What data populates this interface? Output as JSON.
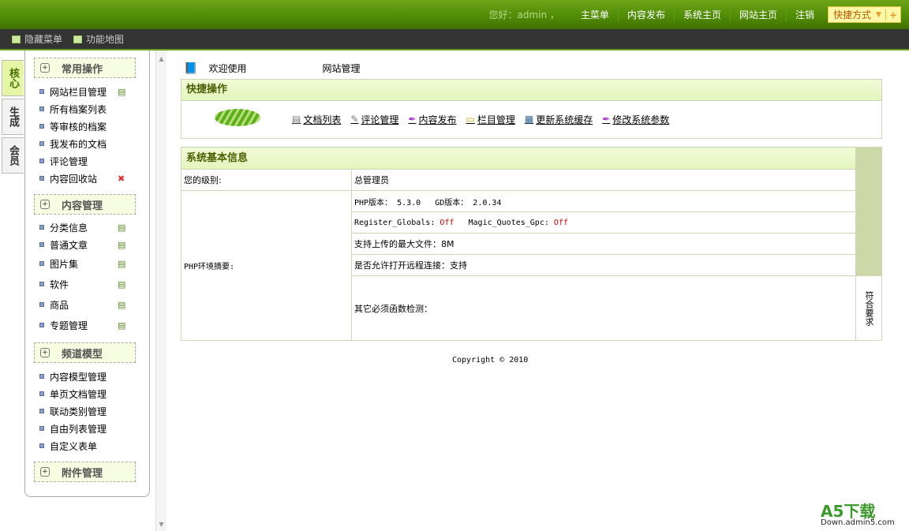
{
  "topnav": {
    "greeting": "您好：admin ，",
    "links": [
      "主菜单",
      "内容发布",
      "系统主页",
      "网站主页",
      "注销"
    ],
    "shortcut": "快捷方式"
  },
  "toolbar": {
    "hide_menu": "隐藏菜单",
    "sitemap": "功能地图"
  },
  "tabs": [
    "核心",
    "生成",
    "会员"
  ],
  "menu": [
    {
      "title": "常用操作",
      "items": [
        "网站栏目管理",
        "所有档案列表",
        "等审核的档案",
        "我发布的文档",
        "评论管理",
        "内容回收站"
      ]
    },
    {
      "title": "内容管理",
      "items": [
        "分类信息",
        "普通文章",
        "图片集",
        "软件",
        "商品",
        "专题管理"
      ]
    },
    {
      "title": "频道模型",
      "items": [
        "内容模型管理",
        "单页文档管理",
        "联动类别管理",
        "自由列表管理",
        "自定义表单"
      ]
    },
    {
      "title": "附件管理",
      "items": []
    }
  ],
  "welcome": {
    "text": "欢迎使用",
    "title": "网站管理"
  },
  "quick": {
    "title": "快捷操作",
    "links": [
      "文档列表",
      "评论管理",
      "内容发布",
      "栏目管理",
      "更新系统缓存",
      "修改系统参数"
    ]
  },
  "sysinfo": {
    "title": "系统基本信息",
    "level_label": "您的级别:",
    "level": "总管理员",
    "php_label": "PHP环境摘要:",
    "php_ver": "PHP版本： 5.3.0   GD版本： 2.0.34",
    "rg_label": "Register_Globals:",
    "rg": "Off",
    "mq_label": "Magic_Quotes_Gpc:",
    "mq": "Off",
    "upload": "支持上传的最大文件：8M",
    "remote": "是否允许打开远程连接：支持",
    "funcs": "其它必须函数检测：",
    "funcs_result": "符合要求"
  },
  "copyright": "Copyright © 2010",
  "watermark": {
    "a": "A5下载",
    "b": "Down.admin5.com"
  }
}
